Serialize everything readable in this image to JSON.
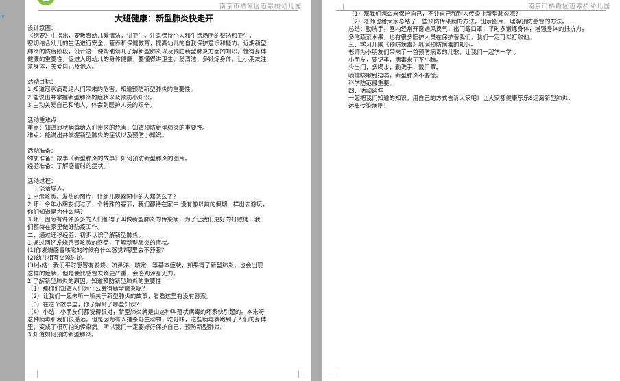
{
  "header": {
    "school": "南京市栖霞区迈皋桥幼儿园"
  },
  "page1": {
    "title": "大班健康：新型肺炎快走开",
    "lines": [
      "设计意图：",
      "《纲要》中指出，要教育幼儿爱清洁，讲卫生，注意保持个人和生活场所的整洁和卫生，",
      "密切结合幼儿的生活进行安全、营养和保健教育，提高幼儿的自我保护意识和能力。近期新型",
      "肺炎的防疫阶段，设计这一课帮助幼儿了解新型肺炎以及预防新型肺炎方面的知识，懂得身体",
      "健康的重要性，促进大班幼儿的身体健康，要懂得讲卫生，爱清洁，多锻炼身体，让小朋友注",
      "意身体，关爱自己及他人。",
      "",
      "活动目标：",
      "1.知道冠状病毒给人们带来的危害，知道预防新型肺炎的重要性。",
      "2.能说出并掌握新型肺炎的症状以及预防小知识。",
      "3.主动关爱自己和他人，体会到医护人员的艰辛。",
      "",
      "活动重难点：",
      "重点：知道冠状病毒给人们带来的危害，知道预防新型肺炎的重要性。",
      "难点：能说出并掌握新型肺炎的症状以及预防小知识。",
      "",
      "活动准备：",
      "物质准备：故事《新型肺炎的故事》如何预防新型肺炎的图片。",
      "经验准备：了解感冒时的症状。",
      "",
      "活动过程：",
      "一、谈话导入。",
      "1.出示咳嗽、发热的图片，让幼儿观察图中的人都怎么了？",
      "2.师：今年小朋友们过了一个特殊的春节，我们都待在家中 没有像以前的假期一样出去游玩，",
      "你们知道是为什么吗？",
      "3.师：因为有许许多多的人们都得了叫做新型肺炎的传染病，为了让我们更好的打败他，我",
      "们都待在家里做好防疫工作。",
      "二、通过迁移经验，初步认识了解新型肺炎。",
      "1.通过回忆发烧感冒咳嗽的感受，了解新型肺炎的症状。",
      "(1)你发烧感冒咳嗽的时候有什么感觉?哪里会不舒服？",
      "(2)幼儿相互交流讨论。",
      "(3)小结：我们平时感冒有发烧、流鼻涕、咳嗽、等基本症状，如果得了新型肺炎，也会出现",
      "这样的症状，但是会比感冒发烧更严重，会感到浑身无力。",
      "2.了解新型肺炎的原因，知道预防新型肺炎的重要性",
      "（1）那你们知道人们为什么会得新型肺炎呢？",
      "（2）让我们一起来听一听关于新型肺炎的故事，看看这里有没有答案。",
      "（3）在这个故事里，你了解到了哪些知识？",
      "（4）小结：小朋友们都说得很对，新型肺炎就是由这种叫冠状病毒的坏家伙引起的。本来呀",
      "这种病毒和我们很遥远，但是因为有人捕杀野生动物，吃野味，这些病毒就跑到了人们的身体",
      "里，变成了很可怕的传染病。所以我们一定要好好保护自己，预防新型肺炎。",
      "3.知道如何预防新型肺炎。"
    ]
  },
  "page2": {
    "lines": [
      "（1）那我们怎么来保护自己，不让自己和别人传染上新型肺炎呢？",
      "（2）老师也给大家总结了一些预防传染病的方法。出示图片，理解预防感冒的方法。",
      "总结：勤洗手，室内经常开窗通风换气，出门戴口罩，平时多锻炼身体，增强身体的抵抗力，",
      "多吃蔬菜水果，也有很多医护人员在保护着我们，我们一定可以打败他。",
      "三、学习儿歌《预防病毒》巩固预防病毒的知识。",
      "    老师为小朋友们带来了一首预防病毒的儿歌，让我们一起学一学 。",
      "小朋友，要记牢，病毒来了不小瞧。",
      "少出门，多喝水，勤洗手，戴口罩。",
      "喷嚏咳嗽肘捂嘴，新型肺炎不要慌。",
      "科学防范最重要。",
      "四、活动延伸",
      "    一起把我们知道的知识，用自己的方式告诉大家吧！让大家都健康乐乐8远离新型肺炎，",
      "远离传染病吧！"
    ]
  },
  "colors": {
    "background": "#ababab",
    "paper": "#ffffff",
    "logo": "#7fbf3f"
  }
}
